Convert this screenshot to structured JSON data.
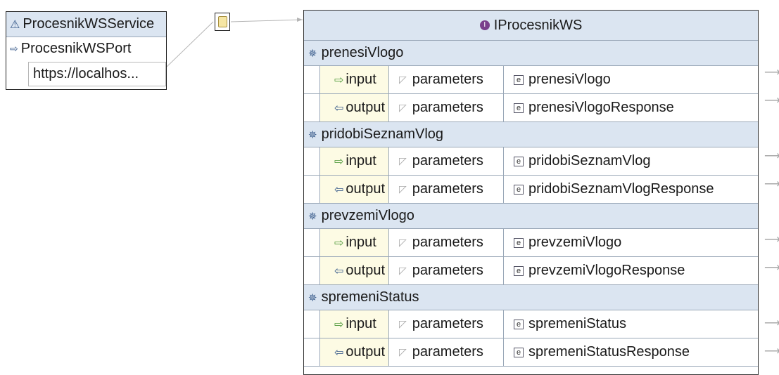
{
  "service": {
    "name": "ProcesnikWSService",
    "port": "ProcesnikWSPort",
    "address": "https://localhos..."
  },
  "interface": {
    "name": "IProcesnikWS",
    "operations": [
      {
        "name": "prenesiVlogo",
        "input": {
          "label": "input",
          "part": "parameters",
          "element": "prenesiVlogo"
        },
        "output": {
          "label": "output",
          "part": "parameters",
          "element": "prenesiVlogoResponse"
        }
      },
      {
        "name": "pridobiSeznamVlog",
        "input": {
          "label": "input",
          "part": "parameters",
          "element": "pridobiSeznamVlog"
        },
        "output": {
          "label": "output",
          "part": "parameters",
          "element": "pridobiSeznamVlogResponse"
        }
      },
      {
        "name": "prevzemiVlogo",
        "input": {
          "label": "input",
          "part": "parameters",
          "element": "prevzemiVlogo"
        },
        "output": {
          "label": "output",
          "part": "parameters",
          "element": "prevzemiVlogoResponse"
        }
      },
      {
        "name": "spremeniStatus",
        "input": {
          "label": "input",
          "part": "parameters",
          "element": "spremeniStatus"
        },
        "output": {
          "label": "output",
          "part": "parameters",
          "element": "spremeniStatusResponse"
        }
      }
    ]
  }
}
